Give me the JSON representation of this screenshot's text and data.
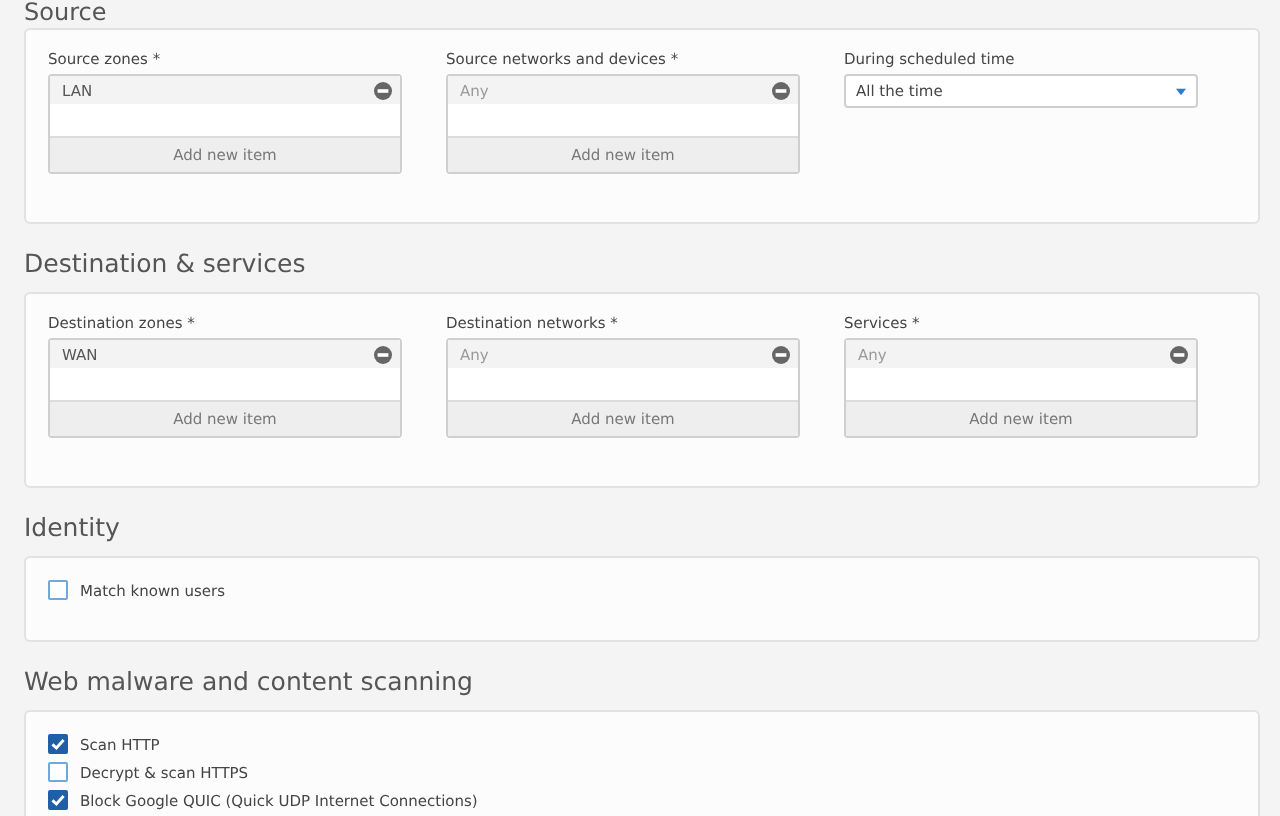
{
  "sections": [
    {
      "title": "Source",
      "fields": [
        {
          "kind": "list",
          "label": "Source zones *",
          "item": "LAN",
          "item_dimmed": false,
          "add": "Add new item"
        },
        {
          "kind": "list",
          "label": "Source networks and devices *",
          "item": "Any",
          "item_dimmed": true,
          "add": "Add new item"
        },
        {
          "kind": "select",
          "label": "During scheduled time",
          "value": "All the time"
        }
      ]
    },
    {
      "title": "Destination & services",
      "fields": [
        {
          "kind": "list",
          "label": "Destination zones *",
          "item": "WAN",
          "item_dimmed": false,
          "add": "Add new item"
        },
        {
          "kind": "list",
          "label": "Destination networks *",
          "item": "Any",
          "item_dimmed": true,
          "add": "Add new item"
        },
        {
          "kind": "list",
          "label": "Services *",
          "item": "Any",
          "item_dimmed": true,
          "add": "Add new item"
        }
      ]
    },
    {
      "title": "Identity",
      "checks": [
        {
          "label": "Match known users",
          "checked": false
        }
      ]
    },
    {
      "title": "Web malware and content scanning",
      "checks": [
        {
          "label": "Scan HTTP",
          "checked": true
        },
        {
          "label": "Decrypt & scan HTTPS",
          "checked": false
        },
        {
          "label": "Block Google QUIC (Quick UDP Internet Connections)",
          "checked": true
        }
      ]
    }
  ]
}
